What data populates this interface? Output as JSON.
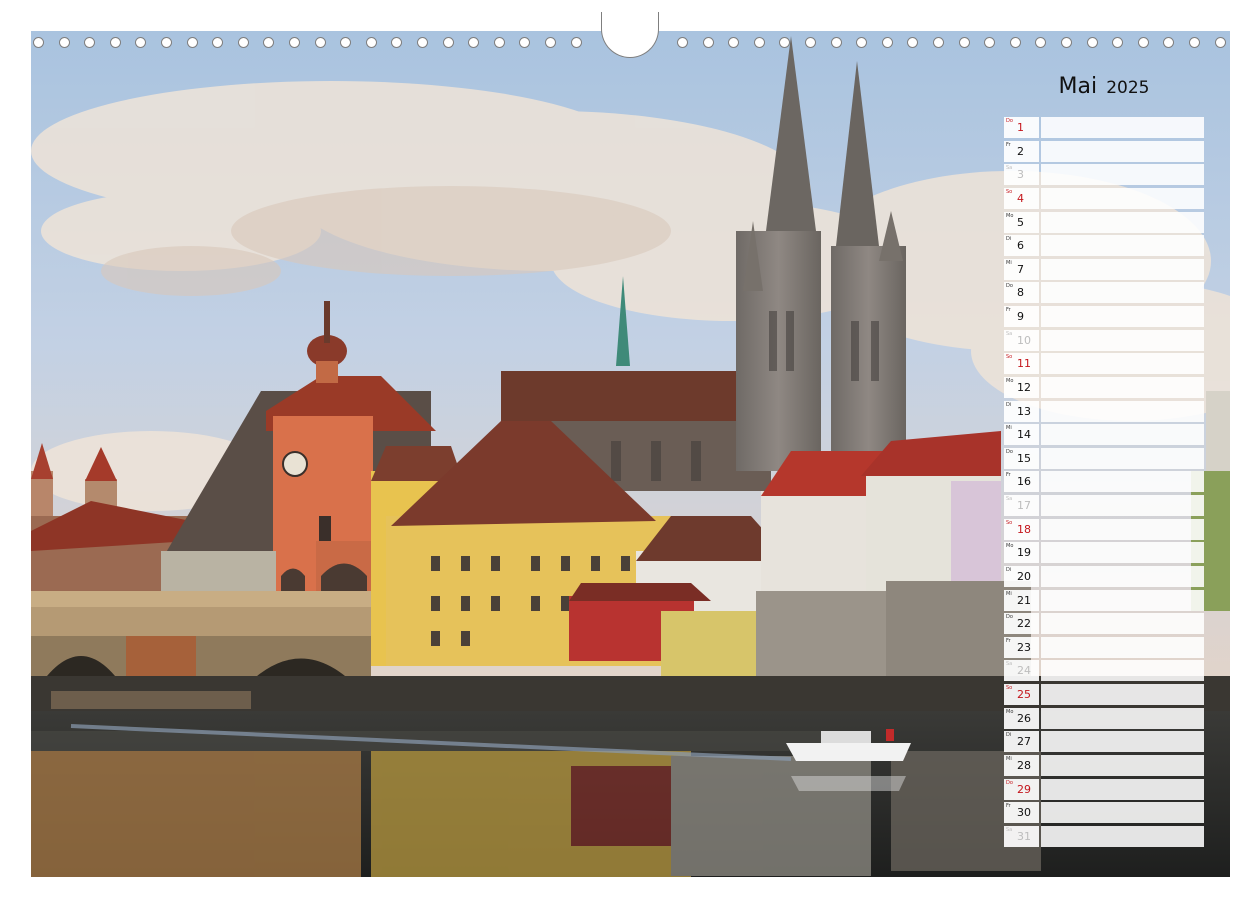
{
  "calendar": {
    "month": "Mai",
    "year": "2025",
    "days": [
      {
        "day": "1",
        "weekday": "Do",
        "type": "holiday"
      },
      {
        "day": "2",
        "weekday": "Fr",
        "type": "weekday"
      },
      {
        "day": "3",
        "weekday": "Sa",
        "type": "saturday"
      },
      {
        "day": "4",
        "weekday": "So",
        "type": "sunday"
      },
      {
        "day": "5",
        "weekday": "Mo",
        "type": "weekday"
      },
      {
        "day": "6",
        "weekday": "Di",
        "type": "weekday"
      },
      {
        "day": "7",
        "weekday": "Mi",
        "type": "weekday"
      },
      {
        "day": "8",
        "weekday": "Do",
        "type": "weekday"
      },
      {
        "day": "9",
        "weekday": "Fr",
        "type": "weekday"
      },
      {
        "day": "10",
        "weekday": "Sa",
        "type": "saturday"
      },
      {
        "day": "11",
        "weekday": "So",
        "type": "sunday"
      },
      {
        "day": "12",
        "weekday": "Mo",
        "type": "weekday"
      },
      {
        "day": "13",
        "weekday": "Di",
        "type": "weekday"
      },
      {
        "day": "14",
        "weekday": "Mi",
        "type": "weekday"
      },
      {
        "day": "15",
        "weekday": "Do",
        "type": "weekday"
      },
      {
        "day": "16",
        "weekday": "Fr",
        "type": "weekday"
      },
      {
        "day": "17",
        "weekday": "Sa",
        "type": "saturday"
      },
      {
        "day": "18",
        "weekday": "So",
        "type": "sunday"
      },
      {
        "day": "19",
        "weekday": "Mo",
        "type": "weekday"
      },
      {
        "day": "20",
        "weekday": "Di",
        "type": "weekday"
      },
      {
        "day": "21",
        "weekday": "Mi",
        "type": "weekday"
      },
      {
        "day": "22",
        "weekday": "Do",
        "type": "weekday"
      },
      {
        "day": "23",
        "weekday": "Fr",
        "type": "weekday"
      },
      {
        "day": "24",
        "weekday": "Sa",
        "type": "saturday"
      },
      {
        "day": "25",
        "weekday": "So",
        "type": "sunday"
      },
      {
        "day": "26",
        "weekday": "Mo",
        "type": "weekday"
      },
      {
        "day": "27",
        "weekday": "Di",
        "type": "weekday"
      },
      {
        "day": "28",
        "weekday": "Mi",
        "type": "weekday"
      },
      {
        "day": "29",
        "weekday": "Do",
        "type": "holiday"
      },
      {
        "day": "30",
        "weekday": "Fr",
        "type": "weekday"
      },
      {
        "day": "31",
        "weekday": "Sa",
        "type": "saturday"
      }
    ]
  },
  "colors": {
    "holiday": "#c4161c",
    "saturday": "#bdbdbd",
    "text": "#111111"
  },
  "icons": {
    "binding": "spiral-ring-icon",
    "hanger": "hanger-hole-icon"
  }
}
